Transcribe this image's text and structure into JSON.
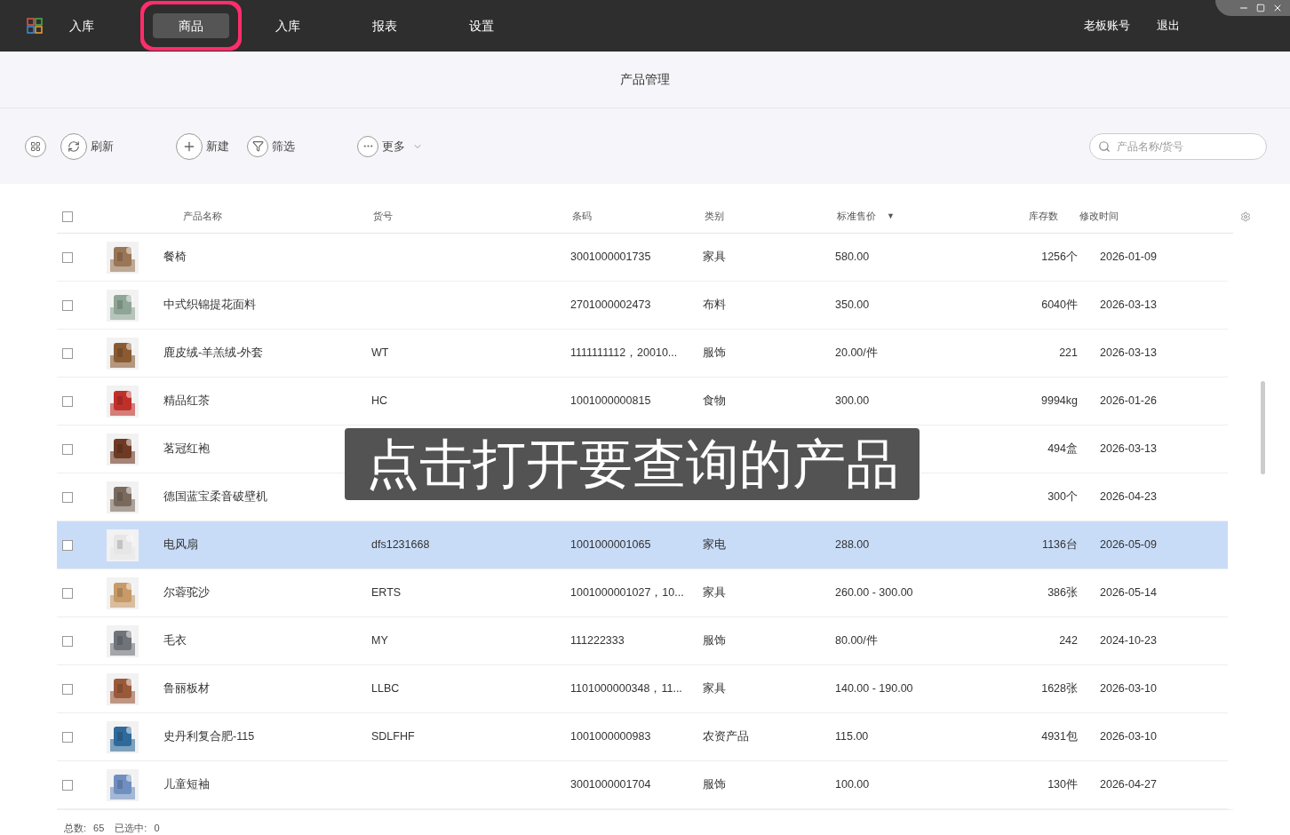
{
  "nav": {
    "tabs": [
      {
        "label": "入库",
        "selected": false
      },
      {
        "label": "商品",
        "selected": true
      },
      {
        "label": "入库",
        "selected": false
      },
      {
        "label": "报表",
        "selected": false
      },
      {
        "label": "设置",
        "selected": false
      }
    ],
    "account": "老板账号",
    "logout": "退出"
  },
  "page_title": "产品管理",
  "toolbar": {
    "actions": [
      {
        "kind": "grid"
      },
      {
        "kind": "refresh",
        "label": "刷新"
      },
      {
        "kind": "add",
        "label": "新建"
      },
      {
        "kind": "filter",
        "label": "筛选"
      },
      {
        "kind": "more",
        "label": "更多"
      }
    ],
    "search": {
      "placeholder": "产品名称/货号"
    }
  },
  "table": {
    "all_checked": false,
    "columns": [
      {
        "label": "产品名称"
      },
      {
        "label": "货号"
      },
      {
        "label": "条码"
      },
      {
        "label": "类别"
      },
      {
        "label": "标准售价",
        "sort_mark": "▼"
      },
      {
        "label": "库存数"
      },
      {
        "label": "修改时间"
      }
    ],
    "rows": [
      {
        "name": "餐椅",
        "barcode": "3001000001735",
        "category": "家具",
        "price": "580.00",
        "stock": "1256个",
        "modified": "2026-01-09",
        "selected": false,
        "checked": false
      },
      {
        "name": "中式织锦提花面料",
        "barcode": "2701000002473",
        "category": "布料",
        "price": "350.00",
        "stock": "6040件",
        "modified": "2026-03-13",
        "selected": false,
        "checked": false
      },
      {
        "name": "鹿皮绒-羊羔绒-外套",
        "code": "WT",
        "barcode": "1111111112，20010...",
        "category": "服饰",
        "price": "20.00/件",
        "stock": "221",
        "modified": "2026-03-13",
        "selected": false,
        "checked": false
      },
      {
        "name": "精品红茶",
        "code": "HC",
        "barcode": "1001000000815",
        "category": "食物",
        "price": "300.00",
        "stock": "9994kg",
        "modified": "2026-01-26",
        "selected": false,
        "checked": false
      },
      {
        "name": "茗冠红袍",
        "stock": "494盒",
        "modified": "2026-03-13",
        "selected": false,
        "checked": false
      },
      {
        "name": "德国蓝宝柔音破壁机",
        "stock": "300个",
        "modified": "2026-04-23",
        "selected": false,
        "checked": false
      },
      {
        "name": "电风扇",
        "code": "dfs1231668",
        "barcode": "1001000001065",
        "category": "家电",
        "price": "288.00",
        "stock": "1136台",
        "modified": "2026-05-09",
        "selected": true,
        "checked": false
      },
      {
        "name": "尔蓉驼沙",
        "code": "ERTS",
        "barcode": "1001000001027，10...",
        "category": "家具",
        "price": "260.00 - 300.00",
        "stock": "386张",
        "modified": "2026-05-14",
        "selected": false,
        "checked": false
      },
      {
        "name": "毛衣",
        "code": "MY",
        "barcode": "111222333",
        "category": "服饰",
        "price": "80.00/件",
        "stock": "242",
        "modified": "2024-10-23",
        "selected": false,
        "checked": false
      },
      {
        "name": "鲁丽板材",
        "code": "LLBC",
        "barcode": "1101000000348，11...",
        "category": "家具",
        "price": "140.00 - 190.00",
        "stock": "1628张",
        "modified": "2026-03-10",
        "selected": false,
        "checked": false
      },
      {
        "name": "史丹利复合肥-115",
        "code": "SDLFHF",
        "barcode": "1001000000983",
        "category": "农资产品",
        "price": "115.00",
        "stock": "4931包",
        "modified": "2026-03-10",
        "selected": false,
        "checked": false
      },
      {
        "name": "儿童短袖",
        "barcode": "3001000001704",
        "category": "服饰",
        "price": "100.00",
        "stock": "130件",
        "modified": "2026-04-27",
        "selected": false,
        "checked": false
      }
    ]
  },
  "footer": {
    "total_label": "总数:",
    "total": "65",
    "selected_label": "已选中:",
    "selected": "0"
  },
  "caption": "点击打开要查询的产品"
}
